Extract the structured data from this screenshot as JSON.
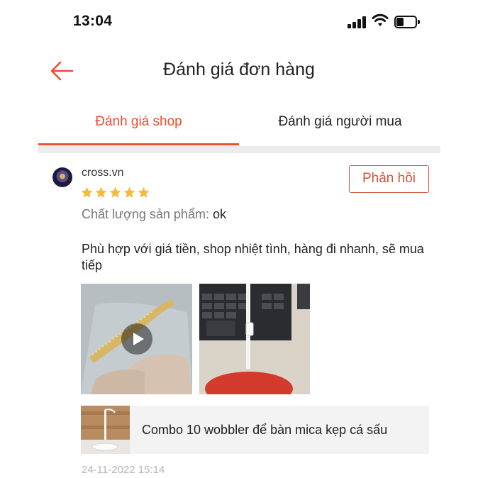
{
  "status_bar": {
    "time": "13:04",
    "icons": [
      "signal-icon",
      "wifi-icon",
      "battery-icon"
    ]
  },
  "header": {
    "back_icon": "arrow-left-icon",
    "title": "Đánh giá đơn hàng"
  },
  "tabs": [
    {
      "label": "Đánh giá shop",
      "active": true
    },
    {
      "label": "Đánh giá người mua",
      "active": false
    }
  ],
  "review": {
    "username": "cross.vn",
    "rating": 5,
    "rating_max": 5,
    "reply_label": "Phản hồi",
    "quality_label": "Chất lượng sản phẩm:",
    "quality_value": "ok",
    "comment": "Phù hợp với giá tiền, shop nhiệt tình, hàng đi nhanh, sẽ mua tiếp",
    "media": [
      {
        "type": "video",
        "icon": "play-icon"
      },
      {
        "type": "image"
      }
    ],
    "product": {
      "name": "Combo 10 wobbler để bàn mica kẹp cá sấu"
    },
    "timestamp": "24-11-2022 15:14"
  },
  "colors": {
    "accent": "#ee4d2d",
    "reply_border": "#d0543f",
    "star": "#f6b93b",
    "muted_text": "#777777",
    "timestamp": "#b5b5b5",
    "product_bg": "#f3f3f3",
    "divider": "#ececec"
  }
}
